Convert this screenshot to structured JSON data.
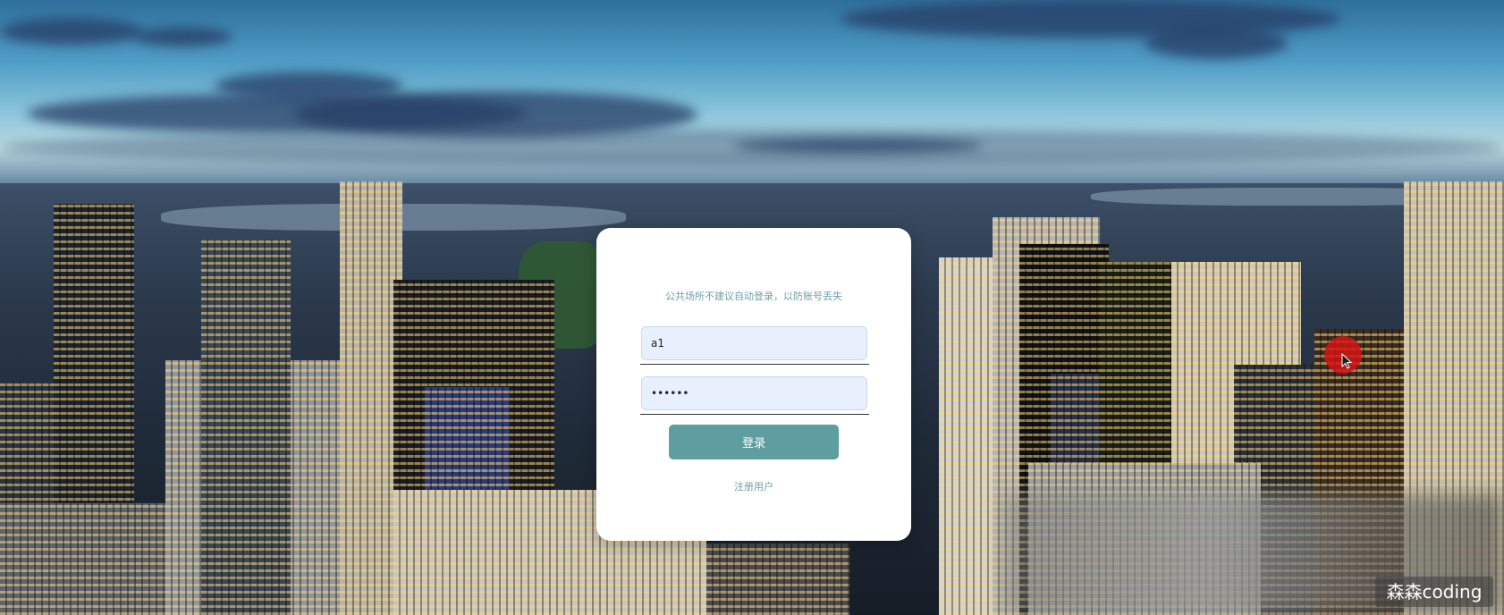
{
  "login": {
    "hint": "公共场所不建议自动登录，以防账号丢失",
    "username_value": "a1",
    "password_value": "••••••",
    "login_button": "登录",
    "register_link": "注册用户"
  },
  "watermark": "森森coding",
  "colors": {
    "button": "#5f9ea0",
    "input_background": "#e8f0fe",
    "hint_text": "#6f9fa4",
    "cursor_highlight": "#d21414"
  },
  "icons": {
    "cursor": "mouse-pointer-icon"
  }
}
